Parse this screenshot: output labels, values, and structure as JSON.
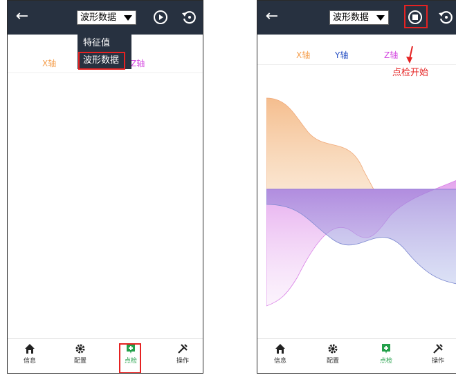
{
  "left": {
    "select_value": "波形数据",
    "dropdown": [
      "特征值",
      "波形数据"
    ],
    "axes": [
      "X轴",
      "Z轴"
    ],
    "nav": [
      {
        "label": "信息",
        "icon": "home-icon"
      },
      {
        "label": "配置",
        "icon": "gear-icon"
      },
      {
        "label": "点检",
        "icon": "inspection-icon"
      },
      {
        "label": "操作",
        "icon": "tools-icon"
      }
    ]
  },
  "right": {
    "select_value": "波形数据",
    "axes": [
      "X轴",
      "Y轴",
      "Z轴"
    ],
    "annotation": "点检开始",
    "nav": [
      {
        "label": "信息",
        "icon": "home-icon"
      },
      {
        "label": "配置",
        "icon": "gear-icon"
      },
      {
        "label": "点检",
        "icon": "inspection-icon"
      },
      {
        "label": "操作",
        "icon": "tools-icon"
      }
    ]
  },
  "colors": {
    "topbar": "#273140",
    "x_axis": "#f5a050",
    "y_axis": "#2a52c4",
    "z_axis": "#d44ae0",
    "highlight": "#e52222",
    "active": "#23a04a"
  }
}
